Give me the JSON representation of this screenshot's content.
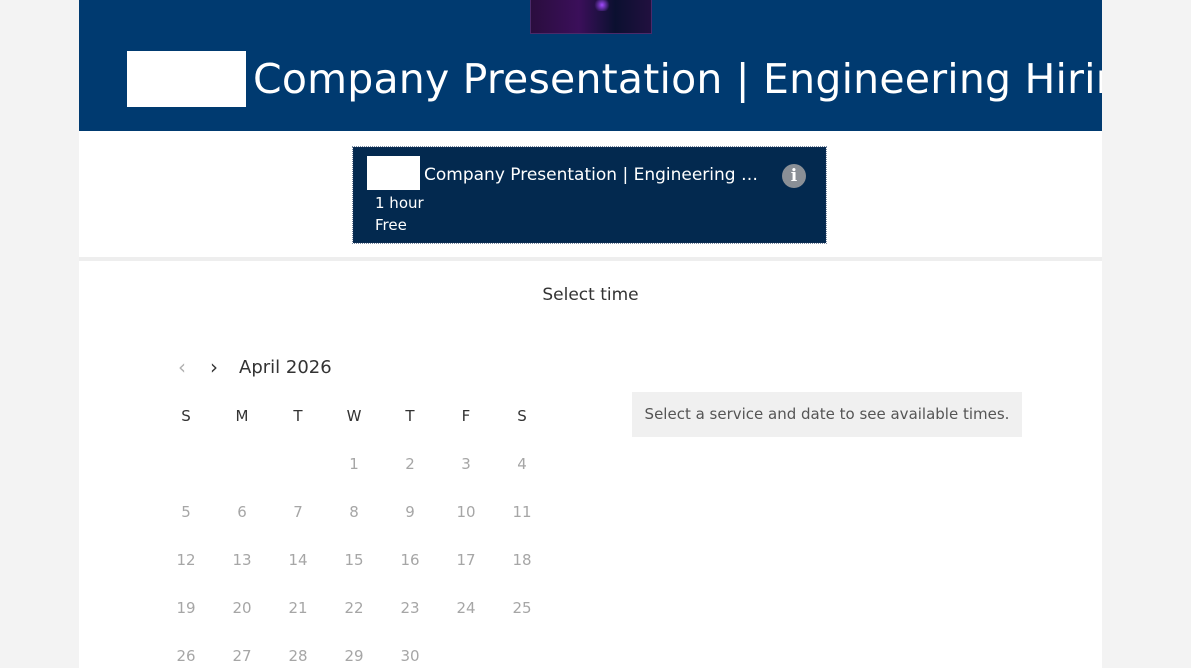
{
  "header": {
    "title": "Company Presentation | Engineering Hiring",
    "bg_color": "#003a70"
  },
  "service": {
    "name": "Company Presentation | Engineering Hiri...",
    "duration": "1 hour",
    "price": "Free",
    "info_icon_label": "i",
    "bg_color": "#03294f"
  },
  "select_time": {
    "title": "Select time"
  },
  "calendar": {
    "prev_icon": "‹",
    "next_icon": "›",
    "month": "April 2026",
    "weekdays": [
      "S",
      "M",
      "T",
      "W",
      "T",
      "F",
      "S"
    ],
    "weeks": [
      [
        "",
        "",
        "",
        "1",
        "2",
        "3",
        "4"
      ],
      [
        "5",
        "6",
        "7",
        "8",
        "9",
        "10",
        "11"
      ],
      [
        "12",
        "13",
        "14",
        "15",
        "16",
        "17",
        "18"
      ],
      [
        "19",
        "20",
        "21",
        "22",
        "23",
        "24",
        "25"
      ],
      [
        "26",
        "27",
        "28",
        "29",
        "30",
        "",
        ""
      ]
    ]
  },
  "times": {
    "message": "Select a service and date to see available times."
  }
}
